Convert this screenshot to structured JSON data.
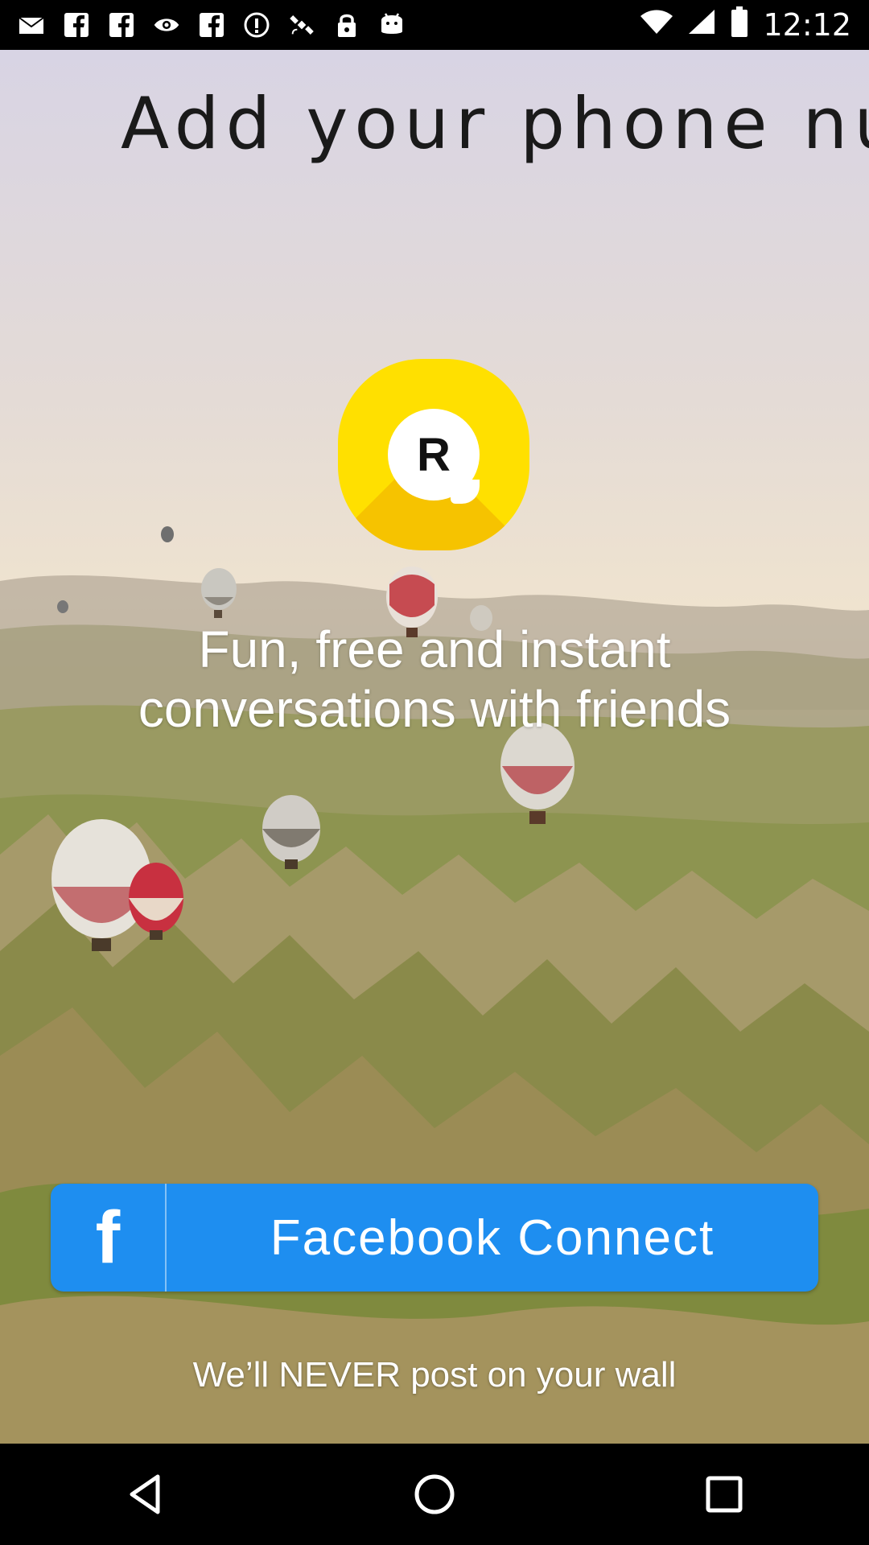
{
  "status_bar": {
    "time": "12:12",
    "icons": [
      "mail-icon",
      "facebook-icon",
      "facebook-icon",
      "eye-icon",
      "facebook-icon",
      "info-icon",
      "satellite-icon",
      "lock-icon",
      "android-icon",
      "wifi-icon",
      "signal-icon",
      "battery-icon"
    ]
  },
  "screen": {
    "title": "Add your phone num",
    "logo_letter": "R",
    "tagline_line1": "Fun, free and instant",
    "tagline_line2": "conversations with friends",
    "facebook_button": {
      "icon_letter": "f",
      "label": "Facebook Connect",
      "color": "#1e8ef0"
    },
    "note": "We’ll NEVER post on your wall"
  },
  "nav_bar": {
    "buttons": [
      "back-icon",
      "home-icon",
      "recents-icon"
    ]
  },
  "colors": {
    "logo_yellow": "#ffe000",
    "logo_shade": "#f6c300"
  }
}
